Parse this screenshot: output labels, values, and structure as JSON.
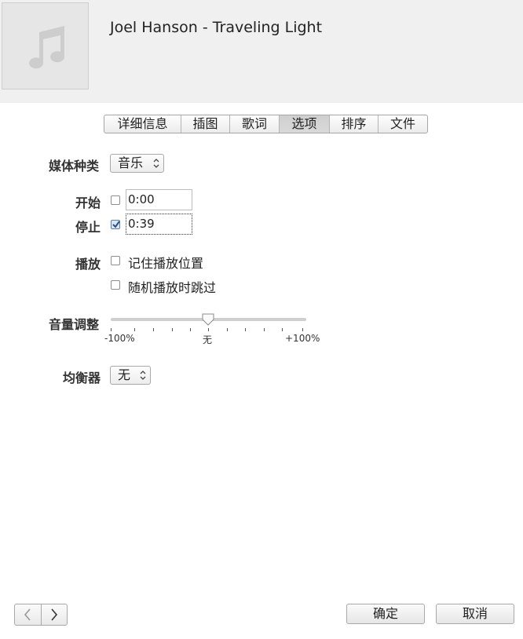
{
  "header": {
    "title": "Joel Hanson - Traveling Light",
    "artwork_icon": "music-note-icon"
  },
  "tabs": [
    {
      "label": "详细信息",
      "active": false
    },
    {
      "label": "插图",
      "active": false
    },
    {
      "label": "歌词",
      "active": false
    },
    {
      "label": "选项",
      "active": true
    },
    {
      "label": "排序",
      "active": false
    },
    {
      "label": "文件",
      "active": false
    }
  ],
  "media_kind": {
    "label": "媒体种类",
    "value": "音乐"
  },
  "start": {
    "label": "开始",
    "checked": false,
    "value": "0:00"
  },
  "stop": {
    "label": "停止",
    "checked": true,
    "value": "0:39"
  },
  "playback": {
    "label": "播放",
    "options": [
      {
        "label": "记住播放位置",
        "checked": false
      },
      {
        "label": "随机播放时跳过",
        "checked": false
      }
    ]
  },
  "volume": {
    "label": "音量调整",
    "min_label": "-100%",
    "mid_label": "无",
    "max_label": "+100%",
    "value_percent": 0
  },
  "equalizer": {
    "label": "均衡器",
    "value": "无"
  },
  "footer": {
    "prev_icon": "chevron-left-icon",
    "next_icon": "chevron-right-icon",
    "ok_label": "确定",
    "cancel_label": "取消"
  },
  "colors": {
    "header_bg": "#f0f0f0",
    "active_tab": "#d4d4d4",
    "checkbox_check": "#2a4f8a"
  }
}
